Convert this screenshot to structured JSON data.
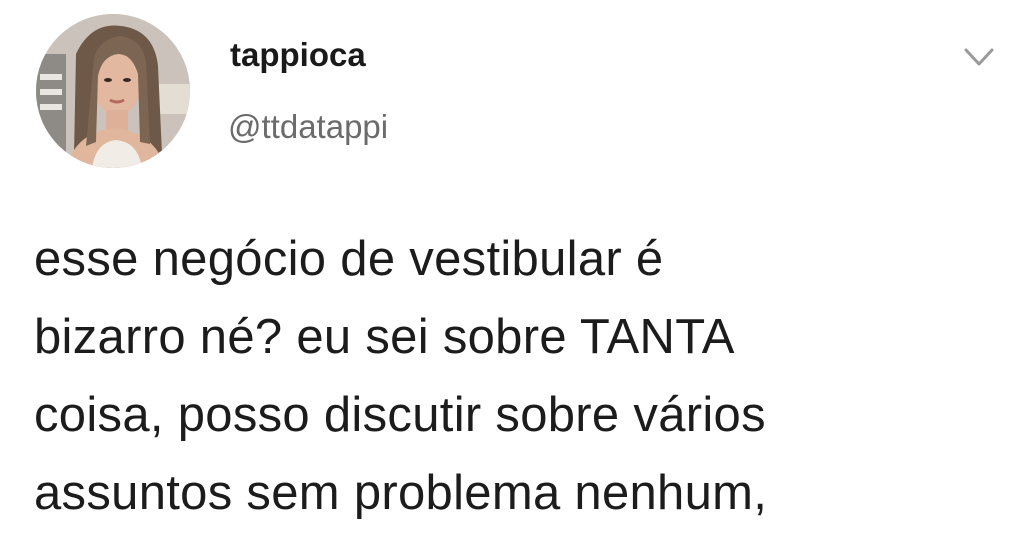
{
  "tweet": {
    "author": {
      "display_name": "tappioca",
      "handle": "@ttdatappi",
      "avatar_icon": "profile-photo"
    },
    "menu_icon": "chevron-down-icon",
    "text_lines": [
      "esse negócio de vestibular é",
      "bizarro né? eu sei sobre TANTA",
      "coisa, posso discutir sobre vários",
      "assuntos sem problema nenhum,"
    ]
  },
  "colors": {
    "text": "#1c1c1c",
    "handle": "#6b6b6b",
    "chevron": "#9a9a9a",
    "background": "#ffffff"
  }
}
